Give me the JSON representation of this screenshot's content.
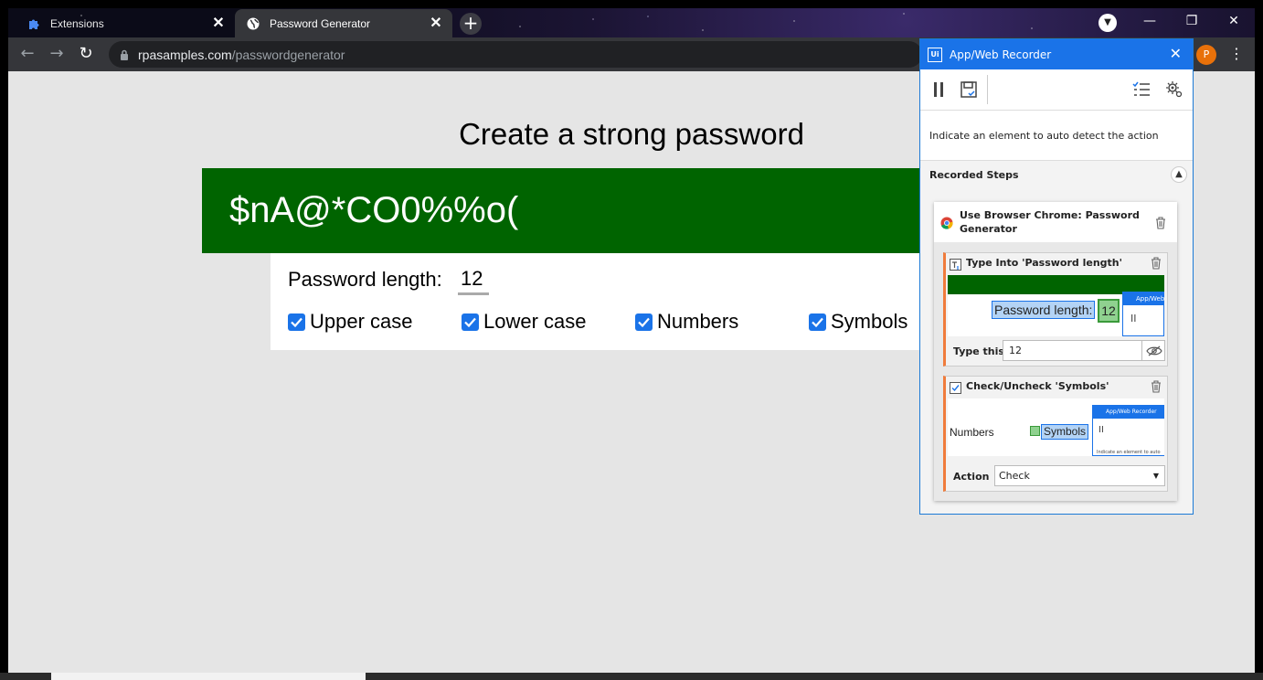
{
  "browser": {
    "tabs": [
      {
        "label": "Extensions",
        "icon": "puzzle-icon",
        "active": false
      },
      {
        "label": "Password Generator",
        "icon": "globe-icon",
        "active": true
      }
    ],
    "new_tab": "+",
    "url_host": "rpasamples.com",
    "url_path": "/passwordgenerator",
    "avatar_letter": "P",
    "colors": {
      "tab_active": "#35363a",
      "toolbar": "#35363a",
      "avatar": "#e8710a"
    }
  },
  "page": {
    "title": "Create a strong password",
    "password": "$nA@*CO0%%o(",
    "length_label": "Password length:",
    "length_value": "12",
    "options": [
      {
        "label": "Upper case",
        "checked": true
      },
      {
        "label": "Lower case",
        "checked": true
      },
      {
        "label": "Numbers",
        "checked": true
      },
      {
        "label": "Symbols",
        "checked": true
      }
    ],
    "colors": {
      "password_bg": "#006400",
      "checkbox": "#1a73e8"
    }
  },
  "recorder": {
    "logo": "Ui",
    "title": "App/Web Recorder",
    "hint": "Indicate an element to auto detect the action",
    "steps_title": "Recorded Steps",
    "scope_title": "Use Browser Chrome: Password Generator",
    "actions": [
      {
        "title": "Type Into 'Password length'",
        "field_label": "Type this",
        "field_value": "12",
        "thumb_text": "Password length:",
        "thumb_value": "12",
        "thumb_mini_title": "App/Web"
      },
      {
        "title": "Check/Uncheck 'Symbols'",
        "field_label": "Action",
        "field_value": "Check",
        "thumb_left": "Numbers",
        "thumb_right": "Symbols",
        "thumb_mini_title": "App/Web Recorder",
        "thumb_mini_hint": "Indicate an element to auto"
      }
    ],
    "colors": {
      "header": "#1a73e8",
      "action_accent": "#f07c3c"
    }
  }
}
